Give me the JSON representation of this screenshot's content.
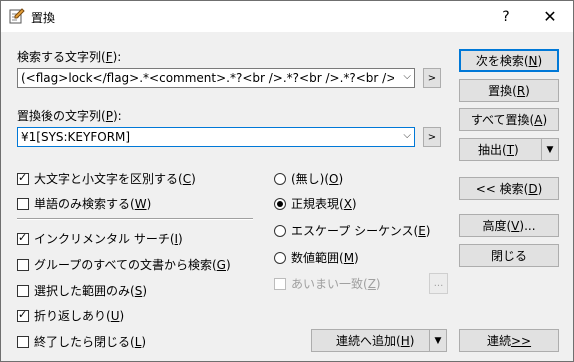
{
  "window": {
    "title": "置換",
    "help": "?",
    "close": "✕"
  },
  "search": {
    "label": "検索する文字列(",
    "label_key": "F",
    "label_end": "):",
    "value": "(<flag>lock</flag>.*<comment>.*?<br />.*?<br />.*?<br />.*",
    "expand": ">"
  },
  "replace": {
    "label": "置換後の文字列(",
    "label_key": "P",
    "label_end": "):",
    "value": "¥1[SYS:KEYFORM]",
    "expand": ">"
  },
  "options": {
    "case": {
      "pre": "大文字と小文字を区別する(",
      "key": "C",
      "post": ")",
      "checked": true
    },
    "word": {
      "pre": "単語のみ検索する(",
      "key": "W",
      "post": ")",
      "checked": false
    },
    "incremental": {
      "pre": "インクリメンタル サーチ(",
      "key": "I",
      "post": ")",
      "checked": true
    },
    "group": {
      "pre": "グループのすべての文書から検索(",
      "key": "G",
      "post": ")",
      "checked": false
    },
    "selection": {
      "pre": "選択した範囲のみ(",
      "key": "S",
      "post": ")",
      "checked": false
    },
    "wrap": {
      "pre": "折り返しあり(",
      "key": "U",
      "post": ")",
      "checked": true
    },
    "closeend": {
      "pre": "終了したら閉じる(",
      "key": "L",
      "post": ")",
      "checked": false
    }
  },
  "modes": {
    "none": {
      "pre": "(無し)(",
      "key": "O",
      "post": ")",
      "selected": false
    },
    "regex": {
      "pre": "正規表現(",
      "key": "X",
      "post": ")",
      "selected": true
    },
    "escape": {
      "pre": "エスケープ シーケンス(",
      "key": "E",
      "post": ")",
      "selected": false
    },
    "range": {
      "pre": "数値範囲(",
      "key": "M",
      "post": ")",
      "selected": false
    },
    "fuzzy": {
      "pre": "あいまい一致(",
      "key": "Z",
      "post": ")",
      "enabled": false
    },
    "fuzzy_btn": "..."
  },
  "buttons": {
    "find_next": {
      "pre": "次を検索(",
      "key": "N",
      "post": ")"
    },
    "replace": {
      "pre": "置換(",
      "key": "R",
      "post": ")"
    },
    "replace_all": {
      "pre": "すべて置換(",
      "key": "A",
      "post": ")"
    },
    "extract": {
      "pre": "抽出(",
      "key": "T",
      "post": ")"
    },
    "find_prev": {
      "pre": "<< 検索(",
      "key": "D",
      "post": ")"
    },
    "advanced": {
      "pre": "高度(",
      "key": "V",
      "post": ")..."
    },
    "close": {
      "label": "閉じる"
    },
    "add_batch": {
      "pre": "連続へ追加(",
      "key": "H",
      "post": ")"
    },
    "batch": {
      "pre": "連続 ",
      "key": ">>",
      "post": ""
    }
  }
}
